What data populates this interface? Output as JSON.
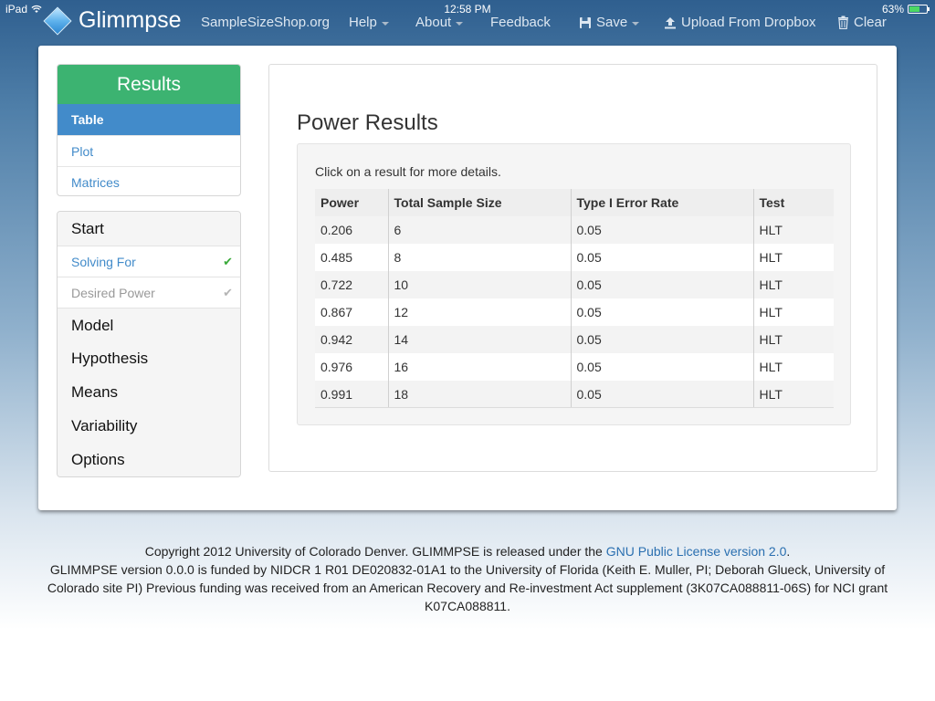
{
  "status_bar": {
    "device": "iPad",
    "time": "12:58 PM",
    "battery": "63%",
    "battery_level": 0.63
  },
  "navbar": {
    "brand": "Glimmpse",
    "site_link": "SampleSizeShop.org",
    "help": "Help",
    "about": "About",
    "feedback": "Feedback",
    "save": "Save",
    "upload": "Upload From Dropbox",
    "clear": "Clear"
  },
  "results_nav": {
    "title": "Results",
    "items": [
      {
        "label": "Table",
        "active": true
      },
      {
        "label": "Plot",
        "active": false
      },
      {
        "label": "Matrices",
        "active": false
      }
    ]
  },
  "steps": {
    "start": "Start",
    "solving_for": "Solving For",
    "desired_power": "Desired Power",
    "model": "Model",
    "hypothesis": "Hypothesis",
    "means": "Means",
    "variability": "Variability",
    "options": "Options"
  },
  "content": {
    "title": "Power Results",
    "instructions": "Click on a result for more details.",
    "columns": [
      "Power",
      "Total Sample Size",
      "Type I Error Rate",
      "Test"
    ],
    "rows": [
      [
        "0.206",
        "6",
        "0.05",
        "HLT"
      ],
      [
        "0.485",
        "8",
        "0.05",
        "HLT"
      ],
      [
        "0.722",
        "10",
        "0.05",
        "HLT"
      ],
      [
        "0.867",
        "12",
        "0.05",
        "HLT"
      ],
      [
        "0.942",
        "14",
        "0.05",
        "HLT"
      ],
      [
        "0.976",
        "16",
        "0.05",
        "HLT"
      ],
      [
        "0.991",
        "18",
        "0.05",
        "HLT"
      ]
    ]
  },
  "footer": {
    "line1_pre": "Copyright 2012 University of Colorado Denver. GLIMMPSE is released under the ",
    "license_link": "GNU Public License version 2.0",
    "line1_post": ".",
    "funding": "GLIMMPSE version 0.0.0 is funded by NIDCR 1 R01 DE020832-01A1 to the University of Florida (Keith E. Muller, PI; Deborah Glueck, University of Colorado site PI) Previous funding was received from an American Recovery and Re-investment Act supplement (3K07CA088811-06S) for NCI grant K07CA088811."
  },
  "colors": {
    "results_header": "#3cb371",
    "active_item": "#428bca",
    "link": "#428bca",
    "check": "#3aaa3a"
  }
}
